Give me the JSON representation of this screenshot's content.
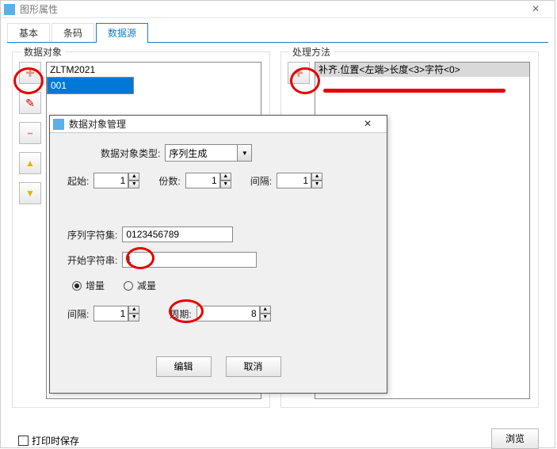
{
  "window": {
    "title": "图形属性"
  },
  "tabs": {
    "t0": "基本",
    "t1": "条码",
    "t2": "数据源"
  },
  "groups": {
    "data": "数据对象",
    "proc": "处理方法"
  },
  "data_list": {
    "r0": "ZLTM2021",
    "r1": "001"
  },
  "proc_list": {
    "r0": "补齐.位置<左端>长度<3>字符<0>"
  },
  "bottom": {
    "save_on_print": "打印时保存",
    "browse": "浏览"
  },
  "modal": {
    "title": "数据对象管理",
    "type_lbl": "数据对象类型:",
    "type_val": "序列生成",
    "start_lbl": "起始:",
    "start_val": "1",
    "count_lbl": "份数:",
    "count_val": "1",
    "gap_lbl": "间隔:",
    "gap_val": "1",
    "charset_lbl": "序列字符集:",
    "charset_val": "0123456789",
    "startstr_lbl": "开始字符串:",
    "startstr_val": "1",
    "inc_lbl": "增量",
    "dec_lbl": "减量",
    "gap2_lbl": "间隔:",
    "gap2_val": "1",
    "period_lbl": "周期:",
    "period_val": "8",
    "edit": "编辑",
    "cancel": "取消"
  }
}
